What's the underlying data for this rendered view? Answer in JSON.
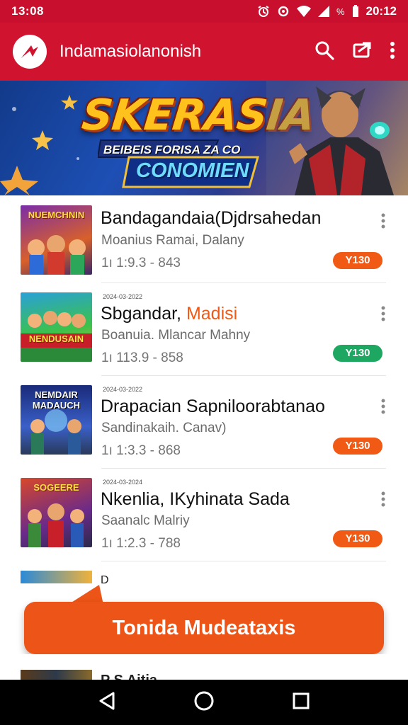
{
  "status_bar": {
    "time": "13:08",
    "battery_pct": "%",
    "clock": "20:12"
  },
  "app_bar": {
    "title": "Indamasiolanonish",
    "icons": [
      "logo-icon",
      "search-icon",
      "cast-icon",
      "more-vert-icon"
    ]
  },
  "banner": {
    "title": "SKERASIA",
    "subtitle_1": "BEIBEIS FORISA ZA CO",
    "subtitle_2": "CONOMIEN"
  },
  "list": {
    "items": [
      {
        "date": "",
        "title": "Bandagandaia(Djdrsahedan",
        "title_accent": "",
        "subtitle": "Moanius Ramai, Dalany",
        "meta": "1ı 1:9.3 - 843",
        "price": "Y130",
        "price_color": "#f05a14",
        "thumb_caption": "NUEMCHNIN"
      },
      {
        "date": "2024-03-2022",
        "title": "Sbgandar, ",
        "title_accent": "Madisi",
        "subtitle": "Boanuia. Mlancar Mahny",
        "meta": "1ı 113.9 - 858",
        "price": "Y130",
        "price_color": "#1ea760",
        "thumb_caption": "NENDUSAIN"
      },
      {
        "date": "2024-03-2022",
        "title": "Drapacian Sapniloorabtanao",
        "title_accent": "",
        "subtitle": "Sandinakaih. Canav)",
        "meta": "1ı 1:3.3 - 868",
        "price": "Y130",
        "price_color": "#f05a14",
        "thumb_caption": "NEMDAIR MADAUCH"
      },
      {
        "date": "2024-03-2024",
        "title": "Nkenlia, IKyhinata Sada",
        "title_accent": "",
        "subtitle": "Saanalc Malriy",
        "meta": "1ı 1:2.3 - 788",
        "price": "Y130",
        "price_color": "#f05a14",
        "thumb_caption": "SOGEERE"
      }
    ],
    "partial_title": "D"
  },
  "cta": {
    "label": "Tonida Mudeataxis"
  },
  "peek": {
    "text": "P  S  Aitia"
  },
  "nav_bar": {
    "icons": [
      "back-icon",
      "home-icon",
      "recents-icon"
    ]
  },
  "colors": {
    "brand_red": "#d0142f",
    "cta_orange": "#ed5417",
    "badge_orange": "#f05a14",
    "badge_green": "#1ea760"
  }
}
